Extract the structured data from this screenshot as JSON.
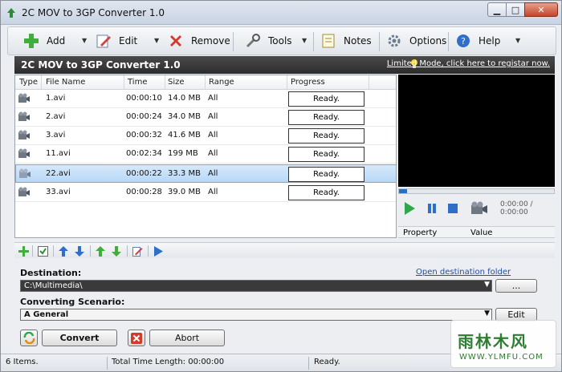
{
  "window": {
    "title": "2C MOV to 3GP Converter 1.0"
  },
  "toolbar": {
    "add": "Add",
    "edit": "Edit",
    "remove": "Remove",
    "tools": "Tools",
    "notes": "Notes",
    "options": "Options",
    "help": "Help"
  },
  "header": {
    "app_title": "2C MOV to 3GP Converter 1.0",
    "limited": "Limited Mode, click here to registar now."
  },
  "table": {
    "columns": [
      "Type",
      "File Name",
      "Time",
      "Size",
      "Range",
      "Progress"
    ],
    "rows": [
      {
        "name": "1.avi",
        "time": "00:00:10",
        "size": "14.0 MB",
        "range": "All",
        "progress": "Ready."
      },
      {
        "name": "2.avi",
        "time": "00:00:24",
        "size": "34.0 MB",
        "range": "All",
        "progress": "Ready."
      },
      {
        "name": "3.avi",
        "time": "00:00:32",
        "size": "41.6 MB",
        "range": "All",
        "progress": "Ready."
      },
      {
        "name": "11.avi",
        "time": "00:02:34",
        "size": "199 MB",
        "range": "All",
        "progress": "Ready."
      },
      {
        "name": "22.avi",
        "time": "00:00:22",
        "size": "33.3 MB",
        "range": "All",
        "progress": "Ready."
      },
      {
        "name": "33.avi",
        "time": "00:00:28",
        "size": "39.0 MB",
        "range": "All",
        "progress": "Ready."
      }
    ]
  },
  "preview": {
    "time": "0:00:00 / 0:00:00",
    "seek_fraction": 0.05
  },
  "properties": {
    "col_property": "Property",
    "col_value": "Value"
  },
  "destination": {
    "label": "Destination:",
    "open_link": "Open destination folder",
    "path": "C:\\Multimedia\\",
    "browse": "..."
  },
  "scenario": {
    "label": "Converting Scenario:",
    "value": "A General",
    "edit": "Edit"
  },
  "actions": {
    "convert": "Convert",
    "abort": "Abort"
  },
  "status": {
    "items": "6 Items.",
    "total": "Total Time Length: 00:00:00",
    "state": "Ready."
  },
  "watermark": {
    "title": "雨林木风",
    "url": "WWW.YLMFU.COM"
  }
}
